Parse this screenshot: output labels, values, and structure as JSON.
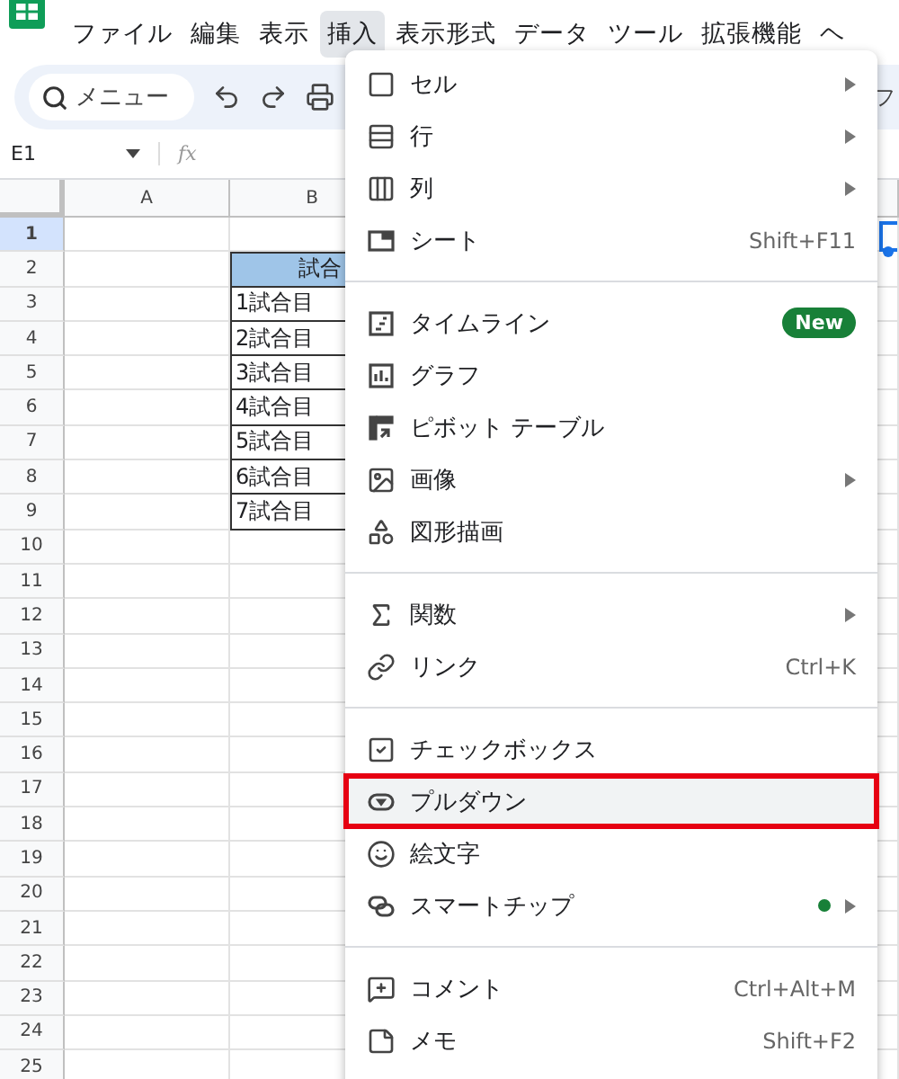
{
  "menubar": {
    "items": [
      {
        "label": "ファイル",
        "selected": false
      },
      {
        "label": "編集",
        "selected": false
      },
      {
        "label": "表示",
        "selected": false
      },
      {
        "label": "挿入",
        "selected": true
      },
      {
        "label": "表示形式",
        "selected": false
      },
      {
        "label": "データ",
        "selected": false
      },
      {
        "label": "ツール",
        "selected": false
      },
      {
        "label": "拡張機能",
        "selected": false
      },
      {
        "label": "ヘ",
        "selected": false
      }
    ]
  },
  "toolbar": {
    "search": {
      "placeholder": "メニュー"
    },
    "overflow_text": "フ"
  },
  "formula_bar": {
    "cell_ref": "E1",
    "fx": "fx"
  },
  "grid": {
    "columns": [
      "A",
      "B"
    ],
    "rows": [
      {
        "number": "1",
        "selected": true
      },
      {
        "number": "2",
        "selected": false
      },
      {
        "number": "3",
        "selected": false
      },
      {
        "number": "4",
        "selected": false
      },
      {
        "number": "5",
        "selected": false
      },
      {
        "number": "6",
        "selected": false
      },
      {
        "number": "7",
        "selected": false
      },
      {
        "number": "8",
        "selected": false
      },
      {
        "number": "9",
        "selected": false
      },
      {
        "number": "10",
        "selected": false
      },
      {
        "number": "11",
        "selected": false
      },
      {
        "number": "12",
        "selected": false
      },
      {
        "number": "13",
        "selected": false
      },
      {
        "number": "14",
        "selected": false
      },
      {
        "number": "15",
        "selected": false
      },
      {
        "number": "16",
        "selected": false
      },
      {
        "number": "17",
        "selected": false
      },
      {
        "number": "18",
        "selected": false
      },
      {
        "number": "19",
        "selected": false
      },
      {
        "number": "20",
        "selected": false
      },
      {
        "number": "21",
        "selected": false
      },
      {
        "number": "22",
        "selected": false
      },
      {
        "number": "23",
        "selected": false
      },
      {
        "number": "24",
        "selected": false
      },
      {
        "number": "25",
        "selected": false
      }
    ]
  },
  "table": {
    "header": "試合",
    "cells": [
      "1試合目",
      "2試合目",
      "3試合目",
      "4試合目",
      "5試合目",
      "6試合目",
      "7試合目"
    ]
  },
  "menu": {
    "sections": [
      [
        {
          "label": "セル",
          "submenu": true,
          "dot": false,
          "selected": false
        },
        {
          "label": "行",
          "submenu": true,
          "dot": false,
          "selected": false
        },
        {
          "label": "列",
          "submenu": true,
          "dot": false,
          "selected": false
        },
        {
          "label": "シート",
          "shortcut": "Shift+F11",
          "submenu": false,
          "dot": false,
          "selected": false
        }
      ],
      [
        {
          "label": "タイムライン",
          "badge": "New",
          "submenu": false,
          "dot": false,
          "selected": false
        },
        {
          "label": "グラフ",
          "submenu": false,
          "dot": false,
          "selected": false
        },
        {
          "label": "ピボット テーブル",
          "submenu": false,
          "dot": false,
          "selected": false
        },
        {
          "label": "画像",
          "submenu": true,
          "dot": false,
          "selected": false
        },
        {
          "label": "図形描画",
          "submenu": false,
          "dot": false,
          "selected": false
        }
      ],
      [
        {
          "label": "関数",
          "submenu": true,
          "dot": false,
          "selected": false
        },
        {
          "label": "リンク",
          "shortcut": "Ctrl+K",
          "submenu": false,
          "dot": false,
          "selected": false
        }
      ],
      [
        {
          "label": "チェックボックス",
          "submenu": false,
          "dot": false,
          "selected": false
        },
        {
          "label": "プルダウン",
          "submenu": false,
          "dot": false,
          "selected": true
        },
        {
          "label": "絵文字",
          "submenu": false,
          "dot": false,
          "selected": false
        },
        {
          "label": "スマートチップ",
          "submenu": true,
          "dot": true,
          "selected": false
        }
      ],
      [
        {
          "label": "コメント",
          "shortcut": "Ctrl+Alt+M",
          "submenu": false,
          "dot": false,
          "selected": false
        },
        {
          "label": "メモ",
          "shortcut": "Shift+F2",
          "submenu": false,
          "dot": false,
          "selected": false
        }
      ]
    ]
  }
}
